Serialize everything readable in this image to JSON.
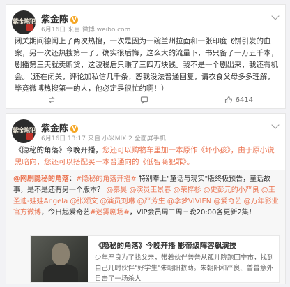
{
  "post1": {
    "author": "紫金陈",
    "verified_badge": "V",
    "meta": "6月16日 来自 微博 weibo.com",
    "avatar_text": "紫金陈犯罪",
    "segments": [
      {
        "t": "闭关期间德闻上了两次热搜，一次是因为一碗兰州拉面和一张印度飞饼引发的血案，另一次还热搜第一了。确实很后悔，这么大的流量下，书只备了一万五千本，剧播第三天就卖断货，这波税后只赚了三四万块钱。我不是一个剧出来，我还有机会。（还在闭关，评论加私信几千条，恕我没法普通回复，请衣食父母多多理解，毕竟微博热搜第一的人，他必定是很忙的啊！）",
        "c": ""
      }
    ],
    "actions": {
      "repost": "",
      "comment": "",
      "like": "6414"
    }
  },
  "post2": {
    "author": "紫金陈",
    "verified_badge": "V",
    "meta": "6月16日 13:17 来自 小米MIX 2 全面屏手机",
    "avatar_text": "紫金陈犯罪",
    "segments": [
      {
        "t": "《隐秘的角落》今晚开播，",
        "c": ""
      },
      {
        "t": "您还可以购物车里加一本原作《坏小孩》，由于原小说黑暗向，您还可以搭配买一本普通向的《低智商犯罪》。",
        "c": "hl"
      }
    ],
    "repost": {
      "author": "@网剧隐秘的角落",
      "line1": "：",
      "segments": [
        {
          "t": "#隐秘的角落开播#",
          "c": "at"
        },
        {
          "t": " 特别奉上\"童话与现实\"版终极预告，童话故事，是不是还有另一个版本？ ",
          "c": ""
        },
        {
          "t": "@秦昊 @演员王景春 @荣梓杉 @史彭元的小严良 @王圣迪-娃娃Angela @张颂文 @演员刘琳 @严芳生 @李梦VIVIEN @爱奇艺 @万年影业官方微博",
          "c": "at"
        },
        {
          "t": "，今日起爱奇艺",
          "c": ""
        },
        {
          "t": "#迷雾剧场#",
          "c": "at"
        },
        {
          "t": "，VIP会员周二周三晚20:00各更新2集！",
          "c": ""
        }
      ],
      "video": {
        "title": "《隐秘的角落》今晚开播 影帝级阵容飙演技",
        "desc": "少年严良为了找父亲，带着伙伴普普从孤儿院跑回宁市，找到自己儿时伙伴\"好学生\"朱朝阳救助。朱朝阳和严良、普普意外目击了一场杀人"
      }
    }
  }
}
